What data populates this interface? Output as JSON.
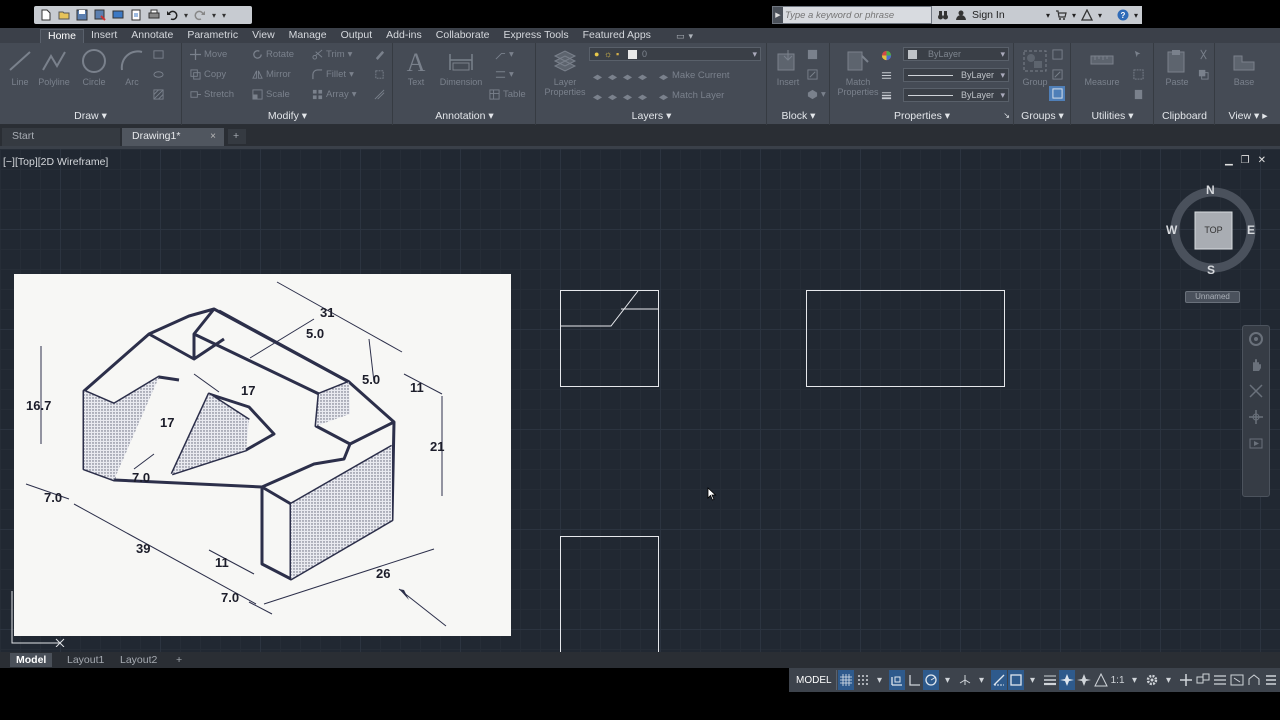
{
  "search": {
    "placeholder": "Type a keyword or phrase"
  },
  "account": {
    "sign_in": "Sign In"
  },
  "ribbon_tabs": [
    "Home",
    "Insert",
    "Annotate",
    "Parametric",
    "View",
    "Manage",
    "Output",
    "Add-ins",
    "Collaborate",
    "Express Tools",
    "Featured Apps"
  ],
  "panels": {
    "draw": {
      "title": "Draw",
      "line": "Line",
      "polyline": "Polyline",
      "circle": "Circle",
      "arc": "Arc"
    },
    "modify": {
      "title": "Modify",
      "move": "Move",
      "rotate": "Rotate",
      "trim": "Trim",
      "copy": "Copy",
      "mirror": "Mirror",
      "fillet": "Fillet",
      "stretch": "Stretch",
      "scale": "Scale",
      "array": "Array"
    },
    "annotation": {
      "title": "Annotation",
      "text": "Text",
      "dimension": "Dimension",
      "table": "Table"
    },
    "layers": {
      "title": "Layers",
      "layer_properties": "Layer Properties",
      "layer_value": "0",
      "make_current": "Make Current",
      "match_layer": "Match Layer"
    },
    "block": {
      "title": "Block",
      "insert": "Insert"
    },
    "properties": {
      "title": "Properties",
      "match_properties": "Match Properties",
      "color": "ByLayer",
      "linetype": "ByLayer",
      "lineweight": "ByLayer"
    },
    "groups": {
      "title": "Groups",
      "group": "Group"
    },
    "utilities": {
      "title": "Utilities",
      "measure": "Measure"
    },
    "clipboard": {
      "title": "Clipboard",
      "paste": "Paste"
    },
    "view": {
      "title": "View",
      "base": "Base"
    }
  },
  "doc_tabs": {
    "start": "Start",
    "drawing": "Drawing1*",
    "plus": "+"
  },
  "viewport": {
    "label": "[−][Top][2D Wireframe]"
  },
  "viewcube": {
    "n": "N",
    "s": "S",
    "e": "E",
    "w": "W",
    "face": "TOP",
    "ucs": "Unnamed"
  },
  "reference_dims": {
    "d31": "31",
    "d5a": "5.0",
    "d5b": "5.0",
    "d11a": "11",
    "d16": "16.7",
    "d17a": "17",
    "d17b": "17",
    "d21": "21",
    "d7a": "7.0",
    "d7b": "7.0",
    "d39": "39",
    "d11b": "11",
    "d26": "26",
    "d7c": "7.0"
  },
  "layout_tabs": {
    "model": "Model",
    "layout1": "Layout1",
    "layout2": "Layout2",
    "plus": "+"
  },
  "status": {
    "model": "MODEL",
    "scale": "1:1"
  },
  "colors": {
    "canvas": "#212832",
    "ribbon": "#454b55",
    "accent": "#2e5a8c"
  }
}
